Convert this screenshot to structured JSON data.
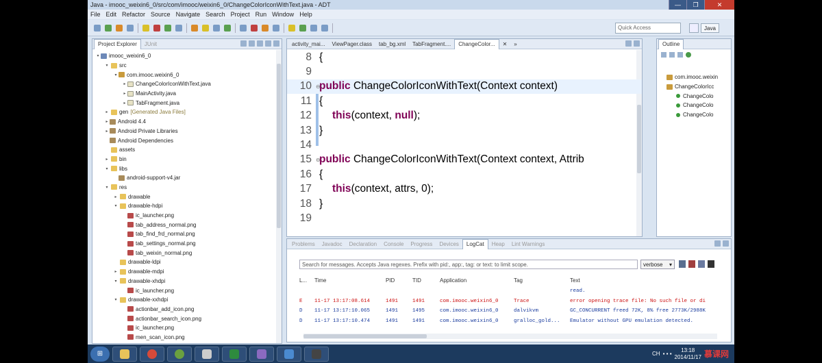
{
  "window": {
    "title": "Java - imooc_weixin6_0/src/com/imooc/weixin6_0/ChangeColorIconWithText.java - ADT"
  },
  "menu": [
    "File",
    "Edit",
    "Refactor",
    "Source",
    "Navigate",
    "Search",
    "Project",
    "Run",
    "Window",
    "Help"
  ],
  "toolbar": {
    "quick_access_placeholder": "Quick Access",
    "perspective": "Java"
  },
  "explorer": {
    "tabs": [
      "Project Explorer",
      "JUnit"
    ],
    "tree": [
      {
        "d": 0,
        "tw": "▾",
        "icon": "proj",
        "label": "imooc_weixin6_0"
      },
      {
        "d": 1,
        "tw": "▾",
        "icon": "fold",
        "label": "src"
      },
      {
        "d": 2,
        "tw": "▾",
        "icon": "pkg",
        "label": "com.imooc.weixin6_0"
      },
      {
        "d": 3,
        "tw": "▸",
        "icon": "java",
        "label": "ChangeColorIconWithText.java"
      },
      {
        "d": 3,
        "tw": "▸",
        "icon": "java",
        "label": "MainActivity.java"
      },
      {
        "d": 3,
        "tw": "▸",
        "icon": "java",
        "label": "TabFragment.java"
      },
      {
        "d": 1,
        "tw": "▸",
        "icon": "fold",
        "label": "gen",
        "extra": "[Generated Java Files]"
      },
      {
        "d": 1,
        "tw": "▸",
        "icon": "lib",
        "label": "Android 4.4"
      },
      {
        "d": 1,
        "tw": "▸",
        "icon": "lib",
        "label": "Android Private Libraries"
      },
      {
        "d": 1,
        "tw": "",
        "icon": "lib",
        "label": "Android Dependencies"
      },
      {
        "d": 1,
        "tw": "",
        "icon": "fold",
        "label": "assets"
      },
      {
        "d": 1,
        "tw": "▸",
        "icon": "fold",
        "label": "bin"
      },
      {
        "d": 1,
        "tw": "▾",
        "icon": "fold",
        "label": "libs"
      },
      {
        "d": 2,
        "tw": "",
        "icon": "lib",
        "label": "android-support-v4.jar"
      },
      {
        "d": 1,
        "tw": "▾",
        "icon": "fold",
        "label": "res"
      },
      {
        "d": 2,
        "tw": "▸",
        "icon": "fold",
        "label": "drawable"
      },
      {
        "d": 2,
        "tw": "▾",
        "icon": "fold",
        "label": "drawable-hdpi"
      },
      {
        "d": 3,
        "tw": "",
        "icon": "img",
        "label": "ic_launcher.png"
      },
      {
        "d": 3,
        "tw": "",
        "icon": "img",
        "label": "tab_address_normal.png"
      },
      {
        "d": 3,
        "tw": "",
        "icon": "img",
        "label": "tab_find_frd_normal.png"
      },
      {
        "d": 3,
        "tw": "",
        "icon": "img",
        "label": "tab_settings_normal.png"
      },
      {
        "d": 3,
        "tw": "",
        "icon": "img",
        "label": "tab_weixin_normal.png"
      },
      {
        "d": 2,
        "tw": "",
        "icon": "fold",
        "label": "drawable-ldpi"
      },
      {
        "d": 2,
        "tw": "▸",
        "icon": "fold",
        "label": "drawable-mdpi"
      },
      {
        "d": 2,
        "tw": "▾",
        "icon": "fold",
        "label": "drawable-xhdpi"
      },
      {
        "d": 3,
        "tw": "",
        "icon": "img",
        "label": "ic_launcher.png"
      },
      {
        "d": 2,
        "tw": "▾",
        "icon": "fold",
        "label": "drawable-xxhdpi"
      },
      {
        "d": 3,
        "tw": "",
        "icon": "img",
        "label": "actionbar_add_icon.png"
      },
      {
        "d": 3,
        "tw": "",
        "icon": "img",
        "label": "actionbar_search_icon.png"
      },
      {
        "d": 3,
        "tw": "",
        "icon": "img",
        "label": "ic_launcher.png"
      },
      {
        "d": 3,
        "tw": "",
        "icon": "img",
        "label": "men_scan_icon.png"
      }
    ]
  },
  "editor": {
    "tabs": [
      "activity_mai...",
      "ViewPager.class",
      "tab_bg.xml",
      "TabFragment....",
      "ChangeColor..."
    ],
    "overflow": "»",
    "current_line": 10,
    "lines": [
      {
        "n": "8",
        "parts": [
          {
            "t": "{"
          }
        ]
      },
      {
        "n": "9",
        "parts": []
      },
      {
        "n": "10",
        "fold": "⊖",
        "parts": [
          {
            "t": "public",
            "k": 1
          },
          {
            "t": " ChangeColorIconWithText(Context context)"
          }
        ]
      },
      {
        "n": "11",
        "parts": [
          {
            "t": "{"
          }
        ]
      },
      {
        "n": "12",
        "indent": 1,
        "parts": [
          {
            "t": "this",
            "k": 1
          },
          {
            "t": "(context, "
          },
          {
            "t": "null",
            "k": 1
          },
          {
            "t": ");"
          }
        ]
      },
      {
        "n": "13",
        "parts": [
          {
            "t": "}"
          }
        ]
      },
      {
        "n": "14",
        "parts": []
      },
      {
        "n": "15",
        "fold": "⊖",
        "parts": [
          {
            "t": "public",
            "k": 1
          },
          {
            "t": " ChangeColorIconWithText(Context context, Attrib"
          }
        ]
      },
      {
        "n": "16",
        "parts": [
          {
            "t": "{"
          }
        ]
      },
      {
        "n": "17",
        "indent": 1,
        "parts": [
          {
            "t": "this",
            "k": 1
          },
          {
            "t": "(context, attrs, 0);"
          }
        ]
      },
      {
        "n": "18",
        "parts": [
          {
            "t": "}"
          }
        ]
      },
      {
        "n": "19",
        "parts": []
      }
    ]
  },
  "outline": {
    "title": "Outline",
    "items": [
      {
        "d": 0,
        "label": "com.imooc.weixin"
      },
      {
        "d": 0,
        "label": "ChangeColorIcc"
      },
      {
        "d": 1,
        "label": "ChangeColo"
      },
      {
        "d": 1,
        "label": "ChangeColo"
      },
      {
        "d": 1,
        "label": "ChangeColo"
      }
    ]
  },
  "bottom": {
    "tabs": [
      "Problems",
      "Javadoc",
      "Declaration",
      "Console",
      "Progress",
      "Devices",
      "LogCat",
      "Heap",
      "Lint Warnings"
    ],
    "active": "LogCat",
    "search_placeholder": "Search for messages. Accepts Java regexes. Prefix with pid:, app:, tag: or text: to limit scope.",
    "level": "verbose",
    "columns": {
      "level": "L...",
      "time": "Time",
      "pid": "PID",
      "tid": "TID",
      "app": "Application",
      "tag": "Tag",
      "text": "Text"
    },
    "rows": [
      {
        "lvl": "",
        "time": "",
        "pid": "",
        "tid": "",
        "app": "",
        "tag": "",
        "text": "read.",
        "kind": "d"
      },
      {
        "lvl": "E",
        "time": "11-17 13:17:08.614",
        "pid": "1491",
        "tid": "1491",
        "app": "com.imooc.weixin6_0",
        "tag": "Trace",
        "text": "error opening trace file: No such file or di",
        "kind": "e"
      },
      {
        "lvl": "D",
        "time": "11-17 13:17:10.065",
        "pid": "1491",
        "tid": "1495",
        "app": "com.imooc.weixin6_0",
        "tag": "dalvikvm",
        "text": "GC_CONCURRENT freed 72K, 8% free 2773K/2988K",
        "kind": "d"
      },
      {
        "lvl": "D",
        "time": "11-17 13:17:10.474",
        "pid": "1491",
        "tid": "1491",
        "app": "com.imooc.weixin6_0",
        "tag": "gralloc_gold...",
        "text": "Emulator without GPU emulation detected.",
        "kind": "d"
      }
    ]
  },
  "taskbar": {
    "start": "⊞",
    "lang": "CH",
    "time": "13:18",
    "date": "2014/11/17",
    "watermark": "慕课网"
  }
}
